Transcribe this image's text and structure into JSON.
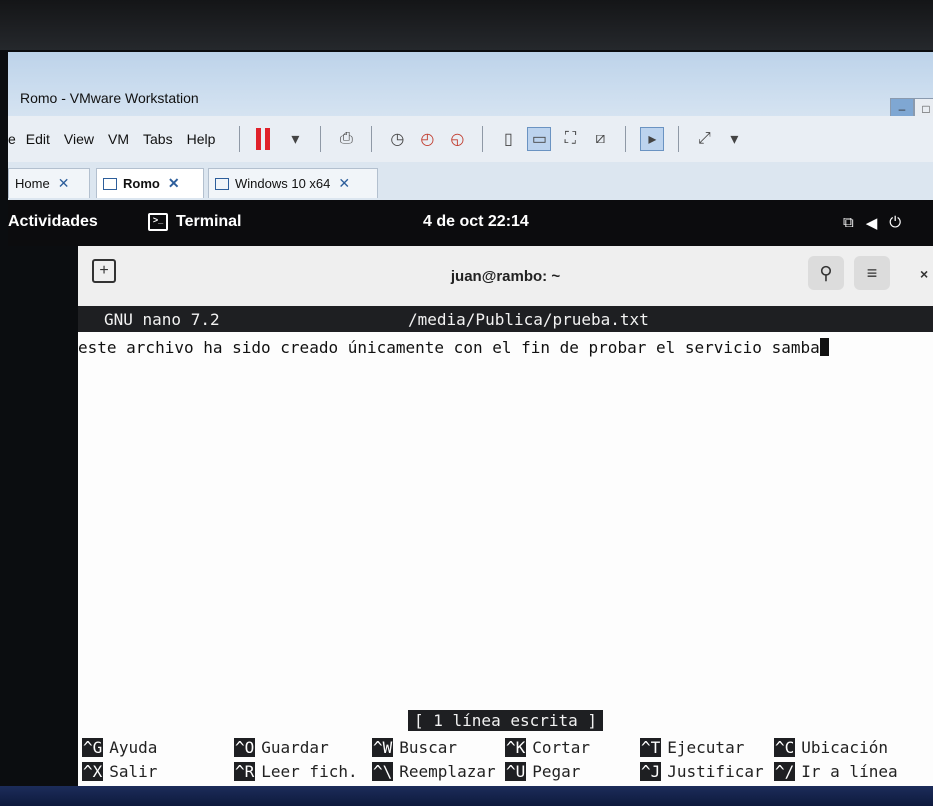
{
  "vmware": {
    "window_title": "Romo - VMware Workstation",
    "menu": [
      "Edit",
      "View",
      "VM",
      "Tabs",
      "Help"
    ],
    "menu_prefix": "e",
    "tabs": [
      {
        "label": "Home",
        "close": "✕"
      },
      {
        "label": "Romo",
        "close": "✕"
      },
      {
        "label": "Windows 10 x64",
        "close": "✕"
      }
    ]
  },
  "gnome": {
    "activities": "Actividades",
    "app_name": "Terminal",
    "clock": "4 de oct 22:14"
  },
  "terminal": {
    "title": "juan@rambo: ~"
  },
  "nano": {
    "version": "GNU nano 7.2",
    "file_path": "/media/Publica/prueba.txt",
    "content": "este archivo ha sido creado únicamente con el fin de probar el servicio samba",
    "status": "[ 1 línea escrita ]",
    "shortcuts_row1": [
      {
        "key": "^G",
        "label": "Ayuda"
      },
      {
        "key": "^O",
        "label": "Guardar"
      },
      {
        "key": "^W",
        "label": "Buscar"
      },
      {
        "key": "^K",
        "label": "Cortar"
      },
      {
        "key": "^T",
        "label": "Ejecutar"
      },
      {
        "key": "^C",
        "label": "Ubicación"
      }
    ],
    "shortcuts_row2": [
      {
        "key": "^X",
        "label": "Salir"
      },
      {
        "key": "^R",
        "label": "Leer fich."
      },
      {
        "key": "^\\",
        "label": "Reemplazar"
      },
      {
        "key": "^U",
        "label": "Pegar"
      },
      {
        "key": "^J",
        "label": "Justificar"
      },
      {
        "key": "^/",
        "label": "Ir a línea"
      }
    ]
  }
}
